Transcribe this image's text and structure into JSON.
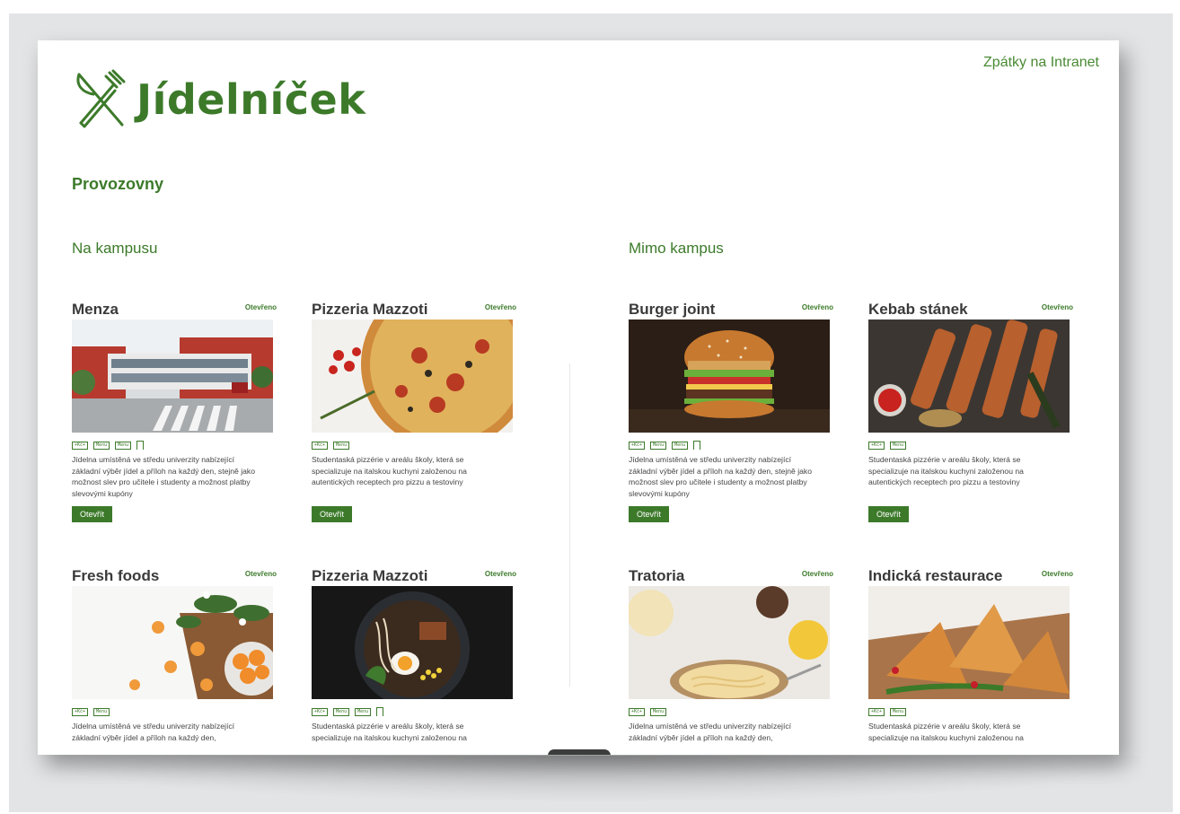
{
  "colors": {
    "green": "#3c7a2a",
    "green_light": "#4a8a34"
  },
  "header": {
    "logo_text": "Jídelníček",
    "back_link": "Zpátky na Intranet"
  },
  "section_title": "Provozovny",
  "columns": {
    "on_campus": "Na kampusu",
    "off_campus": "Mimo kampus"
  },
  "cards": [
    {
      "name": "Menza",
      "status": "Otevřeno",
      "badges": [
        "+Kč+",
        "Menu",
        "Menu"
      ],
      "bookmark": true,
      "desc": "Jídelna umístěná ve středu univerzity nabízející základní výběr jídel a příloh na každý den, stejně jako možnost slev pro učitele i studenty a možnost platby slevovými kupóny",
      "button": "Otevřít",
      "image": "building-photo"
    },
    {
      "name": "Pizzeria Mazzoti",
      "status": "Otevřeno",
      "badges": [
        "+Kč+",
        "Menu"
      ],
      "bookmark": false,
      "desc": "Studentaská pizzérie v areálu školy, která se specializuje na italskou kuchyni založenou na autentických receptech pro pizzu a testoviny",
      "button": "Otevřít",
      "image": "pizza-photo"
    },
    {
      "name": "Burger joint",
      "status": "Otevřeno",
      "badges": [
        "+Kč+",
        "Menu",
        "Menu"
      ],
      "bookmark": true,
      "desc": "Jídelna umístěná ve středu univerzity nabízející základní výběr jídel a příloh na každý den, stejně jako možnost slev pro učitele i studenty a možnost platby slevovými kupóny",
      "button": "Otevřít",
      "image": "burger-photo"
    },
    {
      "name": "Kebab stánek",
      "status": "Otevřeno",
      "badges": [
        "+Kč+",
        "Menu"
      ],
      "bookmark": false,
      "desc": "Studentaská pizzérie v areálu školy, která se specializuje na italskou kuchyni založenou na autentických receptech pro pizzu a testoviny",
      "button": "Otevřít",
      "image": "kebab-photo"
    },
    {
      "name": "Fresh foods",
      "status": "Otevřeno",
      "badges": [
        "+Kč+",
        "Menu"
      ],
      "bookmark": false,
      "desc": "Jídelna umístěná ve středu univerzity nabízející základní výběr jídel a příloh na každý den,",
      "button": "",
      "image": "fruit-photo"
    },
    {
      "name": "Pizzeria Mazzoti",
      "status": "Otevřeno",
      "badges": [
        "+Kč+",
        "Menu",
        "Menu"
      ],
      "bookmark": true,
      "desc": "Studentaská pizzérie v areálu školy, která se specializuje na italskou kuchyni založenou na",
      "button": "",
      "image": "ramen-photo"
    },
    {
      "name": "Tratoria",
      "status": "Otevřeno",
      "badges": [
        "+Kč+",
        "Menu"
      ],
      "bookmark": false,
      "desc": "Jídelna umístěná ve středu univerzity nabízející základní výběr jídel a příloh na každý den,",
      "button": "",
      "image": "pasta-photo"
    },
    {
      "name": "Indická restaurace",
      "status": "Otevřeno",
      "badges": [
        "+Kč+",
        "Menu"
      ],
      "bookmark": false,
      "desc": "Studentaská pizzérie v areálu školy, která se specializuje na italskou kuchyni založenou na",
      "button": "",
      "image": "samosa-photo"
    }
  ]
}
